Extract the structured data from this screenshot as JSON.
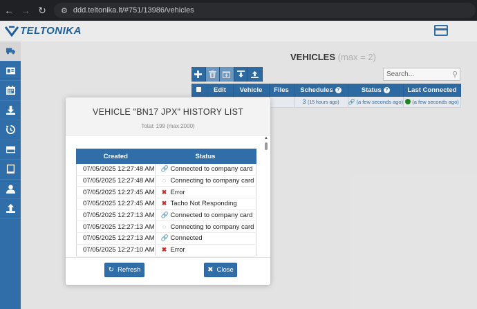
{
  "browser": {
    "url": "ddd.teltonika.lt/#751/13986/vehicles",
    "icons": [
      "back-icon",
      "forward-icon",
      "reload-icon",
      "site-settings-icon"
    ]
  },
  "app": {
    "logo_text": "TELTONIKA",
    "accent": "#2f6ea8"
  },
  "sidebar": {
    "items": [
      {
        "name": "vehicles",
        "icon": "truck-icon"
      },
      {
        "name": "drivers",
        "icon": "id-card-icon"
      },
      {
        "name": "calendar",
        "icon": "calendar-icon"
      },
      {
        "name": "downloads",
        "icon": "download-icon"
      },
      {
        "name": "history",
        "icon": "history-icon"
      },
      {
        "name": "company-cards",
        "icon": "credit-card-icon"
      },
      {
        "name": "devices",
        "icon": "tablet-icon"
      },
      {
        "name": "users",
        "icon": "user-icon"
      },
      {
        "name": "upload",
        "icon": "upload-icon"
      }
    ]
  },
  "page": {
    "title": "VEHICLES",
    "max_text": "(max = 2)"
  },
  "search": {
    "placeholder": "Search..."
  },
  "vehicles_table": {
    "headers": {
      "edit": "Edit",
      "vehicle": "Vehicle",
      "files": "Files",
      "schedules": "Schedules",
      "status": "Status",
      "last_connected": "Last Connected"
    },
    "row": {
      "schedules_count": "3",
      "schedules_ago": "(15 hours ago)",
      "status_ago": "(a few seconds ago)",
      "last_connected_ago": "(a few seconds ago)"
    }
  },
  "modal": {
    "title": "VEHICLE \"BN17 JPX\" HISTORY LIST",
    "subtitle": "Total: 199 (max:2000)",
    "headers": {
      "created": "Created",
      "status": "Status"
    },
    "rows": [
      {
        "created": "07/05/2025 12:27:48 AM",
        "status": "Connected to company card",
        "kind": "ok"
      },
      {
        "created": "07/05/2025 12:27:48 AM",
        "status": "Connecting to company card ...",
        "kind": "wait"
      },
      {
        "created": "07/05/2025 12:27:45 AM",
        "status": "Error",
        "kind": "err"
      },
      {
        "created": "07/05/2025 12:27:45 AM",
        "status": "Tacho Not Responding",
        "kind": "err"
      },
      {
        "created": "07/05/2025 12:27:13 AM",
        "status": "Connected to company card",
        "kind": "ok"
      },
      {
        "created": "07/05/2025 12:27:13 AM",
        "status": "Connecting to company card ...",
        "kind": "wait"
      },
      {
        "created": "07/05/2025 12:27:13 AM",
        "status": "Connected",
        "kind": "ok"
      },
      {
        "created": "07/05/2025 12:27:10 AM",
        "status": "Error",
        "kind": "err"
      }
    ],
    "refresh_label": "Refresh",
    "close_label": "Close"
  }
}
